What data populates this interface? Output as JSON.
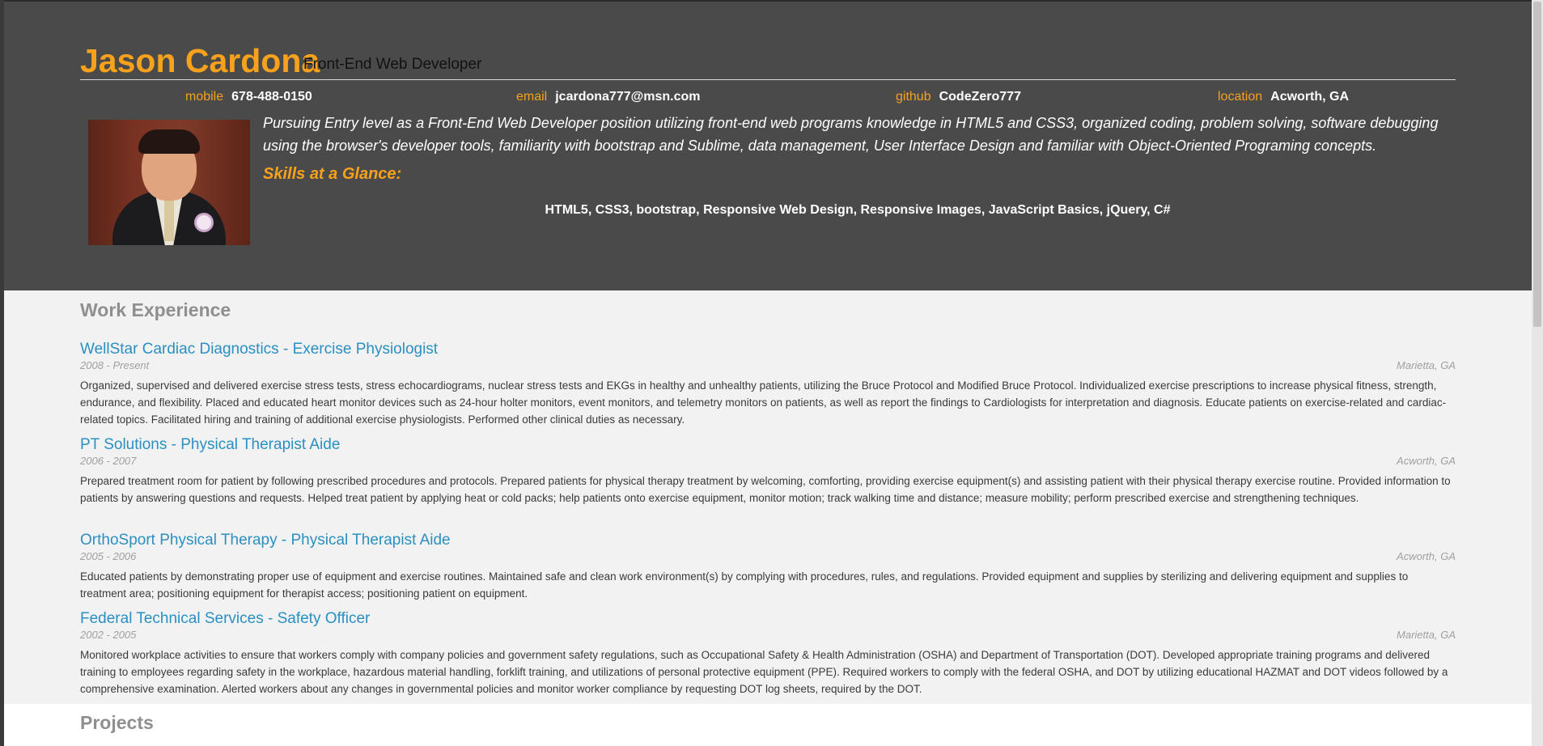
{
  "header": {
    "name": "Jason Cardona",
    "role": "Front-End Web Developer",
    "contacts": [
      {
        "label": "mobile",
        "value": "678-488-0150"
      },
      {
        "label": "email",
        "value": "jcardona777@msn.com"
      },
      {
        "label": "github",
        "value": "CodeZero777"
      },
      {
        "label": "location",
        "value": "Acworth, GA"
      }
    ],
    "summary": " Pursuing Entry level as a Front-End Web Developer position utilizing front-end web programs knowledge in HTML5 and CSS3, organized coding, problem solving, software debugging using the browser's developer tools, familiarity with bootstrap and Sublime, data management, User Interface Design and familiar with Object-Oriented Programing concepts.",
    "skills_heading": "Skills at a Glance:",
    "skills": "HTML5, CSS3, bootstrap, Responsive Web Design, Responsive Images, JavaScript Basics, jQuery, C#"
  },
  "work": {
    "heading": "Work Experience",
    "jobs": [
      {
        "title": "WellStar Cardiac Diagnostics - Exercise Physiologist",
        "dates": "2008 - Present",
        "location": "Marietta, GA",
        "description": "Organized, supervised and delivered exercise stress tests, stress echocardiograms, nuclear stress tests and EKGs in healthy and unhealthy patients, utilizing the Bruce Protocol and Modified Bruce Protocol. Individualized exercise prescriptions to increase physical fitness, strength, endurance, and flexibility. Placed and educated heart monitor devices such as 24-hour holter monitors, event monitors, and telemetry monitors on patients, as well as report the findings to Cardiologists for interpretation and diagnosis. Educate patients on exercise-related and cardiac-related topics. Facilitated hiring and training of additional exercise physiologists. Performed other clinical duties as necessary."
      },
      {
        "title": "PT Solutions - Physical Therapist Aide",
        "dates": "2006 - 2007",
        "location": "Acworth, GA",
        "description": "Prepared treatment room for patient by following prescribed procedures and protocols. Prepared patients for physical therapy treatment by welcoming, comforting, providing exercise equipment(s) and assisting patient with their physical therapy exercise routine. Provided information to patients by answering questions and requests. Helped treat patient by applying heat or cold packs; help patients onto exercise equipment, monitor motion; track walking time and distance; measure mobility; perform prescribed exercise and strengthening techniques."
      },
      {
        "title": "OrthoSport Physical Therapy - Physical Therapist Aide",
        "dates": "2005 - 2006",
        "location": "Acworth, GA",
        "description": "Educated patients by demonstrating proper use of equipment and exercise routines. Maintained safe and clean work environment(s) by complying with procedures, rules, and regulations. Provided equipment and supplies by sterilizing and delivering equipment and supplies to treatment area; positioning equipment for therapist access; positioning patient on equipment."
      },
      {
        "title": "Federal Technical Services - Safety Officer",
        "dates": "2002 - 2005",
        "location": "Marietta, GA",
        "description": "Monitored workplace activities to ensure that workers comply with company policies and government safety regulations, such as Occupational Safety & Health Administration (OSHA) and Department of Transportation (DOT). Developed appropriate training programs and delivered training to employees regarding safety in the workplace, hazardous material handling, forklift training, and utilizations of personal protective equipment (PPE). Required workers to comply with the federal OSHA, and DOT by utilizing educational HAZMAT and DOT videos followed by a comprehensive examination. Alerted workers about any changes in governmental policies and monitor worker compliance by requesting DOT log sheets, required by the DOT."
      }
    ]
  },
  "projects": {
    "heading": "Projects"
  },
  "colors": {
    "accent": "#f7a11c",
    "header_bg": "#4a4a4a",
    "link": "#2a90c2",
    "page_bg": "#f2f2f2"
  }
}
